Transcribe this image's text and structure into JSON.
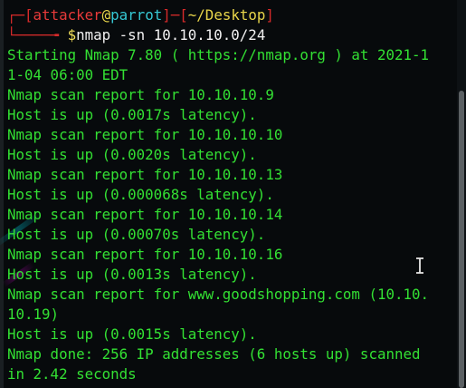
{
  "window": {
    "title": "attacker@parrot: ~/Desktop"
  },
  "prompt": {
    "open_bracket": "[",
    "user": "attacker",
    "at": "@",
    "host": "parrot",
    "close_bracket": "]",
    "dash": "─",
    "path_open": "[",
    "path": "~/Desktop",
    "path_close": "]",
    "corner_top": "┌─",
    "corner_bottom": "└────╼ ",
    "symbol": "$",
    "command": "nmap -sn 10.10.10.0/24"
  },
  "output": [
    "Starting Nmap 7.80 ( https://nmap.org ) at 2021-1",
    "1-04 06:00 EDT",
    "Nmap scan report for 10.10.10.9",
    "Host is up (0.0017s latency).",
    "Nmap scan report for 10.10.10.10",
    "Host is up (0.0020s latency).",
    "Nmap scan report for 10.10.10.13",
    "Host is up (0.000068s latency).",
    "Nmap scan report for 10.10.10.14",
    "Host is up (0.00070s latency).",
    "Nmap scan report for 10.10.10.16",
    "Host is up (0.0013s latency).",
    "Nmap scan report for www.goodshopping.com (10.10.",
    "10.19)",
    "Host is up (0.0015s latency).",
    "Nmap done: 256 IP addresses (6 hosts up) scanned",
    "in 2.42 seconds"
  ],
  "colors": {
    "background": "#070a0c",
    "output_text": "#33e033",
    "prompt_red": "#d62a2a",
    "prompt_yellow": "#e8d54a",
    "command_text": "#f2f2f2"
  },
  "icons": {
    "text_cursor": "i-beam-cursor-icon"
  }
}
